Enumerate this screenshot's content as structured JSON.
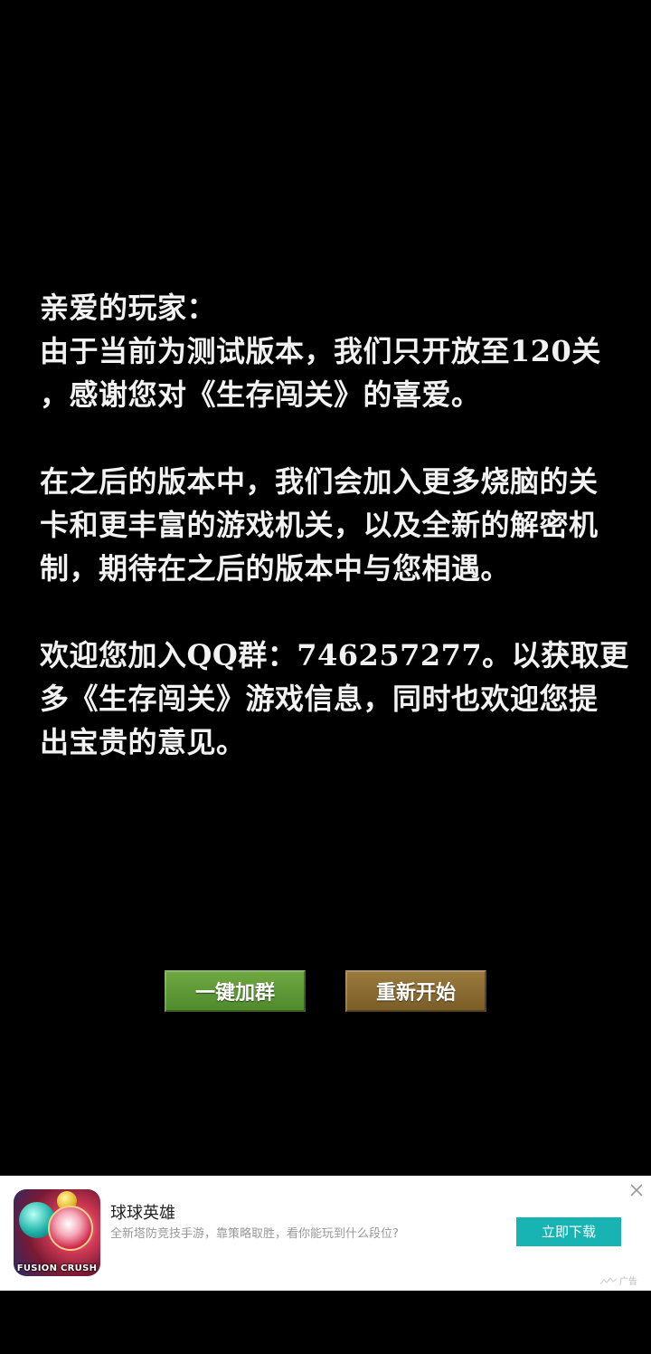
{
  "message": {
    "greeting": "亲爱的玩家：",
    "paragraph1": [
      "由于当前为测试版本，我们只开放至120关",
      "，感谢您对《生存闯关》的喜爱。"
    ],
    "paragraph2": [
      "在之后的版本中，我们会加入更多烧脑的关",
      "卡和更丰富的游戏机关，以及全新的解密机",
      "制，期待在之后的版本中与您相遇。"
    ],
    "paragraph3": [
      "欢迎您加入QQ群：746257277。以获取更",
      "多《生存闯关》游戏信息，同时也欢迎您提",
      "出宝贵的意见。"
    ]
  },
  "buttons": {
    "join_group": "一键加群",
    "restart": "重新开始"
  },
  "ad": {
    "icon": "fusion-crush-app-icon",
    "icon_logo_text": "FUSION CRUSH",
    "title": "球球英雄",
    "description": "全新塔防竞技手游，靠策略取胜，看你能玩到什么段位?",
    "cta_label": "立即下载",
    "close_icon": "close-icon",
    "ad_label": "广告",
    "cta_color": "#18b3b3"
  },
  "colors": {
    "background": "#000000",
    "text": "#f2f2f2",
    "join_button": "#5e9a37",
    "restart_button": "#8b6b31"
  }
}
